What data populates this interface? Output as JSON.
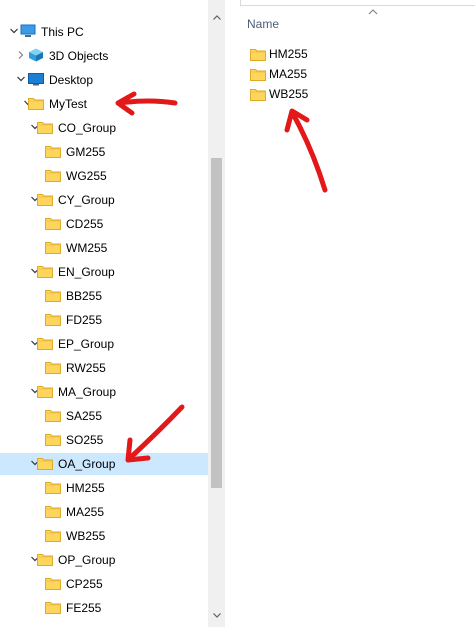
{
  "nav_tree": [
    {
      "label": "This PC",
      "indent": 0,
      "icon": "this-pc-icon",
      "chevron": "expanded"
    },
    {
      "label": "3D Objects",
      "indent": 1,
      "icon": "3d-objects-icon",
      "chevron": "collapsed"
    },
    {
      "label": "Desktop",
      "indent": 1,
      "icon": "desktop-icon",
      "chevron": "expanded"
    },
    {
      "label": "MyTest",
      "indent": 2,
      "icon": "folder-icon",
      "chevron": "expanded"
    },
    {
      "label": "CO_Group",
      "indent": 3,
      "icon": "folder-icon",
      "chevron": "expanded"
    },
    {
      "label": "GM255",
      "indent": 4,
      "icon": "folder-icon",
      "chevron": "none"
    },
    {
      "label": "WG255",
      "indent": 4,
      "icon": "folder-icon",
      "chevron": "none"
    },
    {
      "label": "CY_Group",
      "indent": 3,
      "icon": "folder-icon",
      "chevron": "expanded"
    },
    {
      "label": "CD255",
      "indent": 4,
      "icon": "folder-icon",
      "chevron": "none"
    },
    {
      "label": "WM255",
      "indent": 4,
      "icon": "folder-icon",
      "chevron": "none"
    },
    {
      "label": "EN_Group",
      "indent": 3,
      "icon": "folder-icon",
      "chevron": "expanded"
    },
    {
      "label": "BB255",
      "indent": 4,
      "icon": "folder-icon",
      "chevron": "none"
    },
    {
      "label": "FD255",
      "indent": 4,
      "icon": "folder-icon",
      "chevron": "none"
    },
    {
      "label": "EP_Group",
      "indent": 3,
      "icon": "folder-icon",
      "chevron": "expanded"
    },
    {
      "label": "RW255",
      "indent": 4,
      "icon": "folder-icon",
      "chevron": "none"
    },
    {
      "label": "MA_Group",
      "indent": 3,
      "icon": "folder-icon",
      "chevron": "expanded"
    },
    {
      "label": "SA255",
      "indent": 4,
      "icon": "folder-icon",
      "chevron": "none"
    },
    {
      "label": "SO255",
      "indent": 4,
      "icon": "folder-icon",
      "chevron": "none"
    },
    {
      "label": "OA_Group",
      "indent": 3,
      "icon": "folder-icon",
      "chevron": "expanded",
      "selected": true
    },
    {
      "label": "HM255",
      "indent": 4,
      "icon": "folder-icon",
      "chevron": "none"
    },
    {
      "label": "MA255",
      "indent": 4,
      "icon": "folder-icon",
      "chevron": "none"
    },
    {
      "label": "WB255",
      "indent": 4,
      "icon": "folder-icon",
      "chevron": "none"
    },
    {
      "label": "OP_Group",
      "indent": 3,
      "icon": "folder-icon",
      "chevron": "expanded"
    },
    {
      "label": "CP255",
      "indent": 4,
      "icon": "folder-icon",
      "chevron": "none"
    },
    {
      "label": "FE255",
      "indent": 4,
      "icon": "folder-icon",
      "chevron": "none"
    }
  ],
  "content": {
    "column_header": "Name",
    "files": [
      {
        "label": "HM255",
        "icon": "folder-icon"
      },
      {
        "label": "MA255",
        "icon": "folder-icon"
      },
      {
        "label": "WB255",
        "icon": "folder-icon"
      }
    ]
  },
  "colors": {
    "selection": "#cce8ff",
    "folder": "#ffd65c",
    "annotation": "#e31818",
    "header_text": "#4c607a"
  }
}
